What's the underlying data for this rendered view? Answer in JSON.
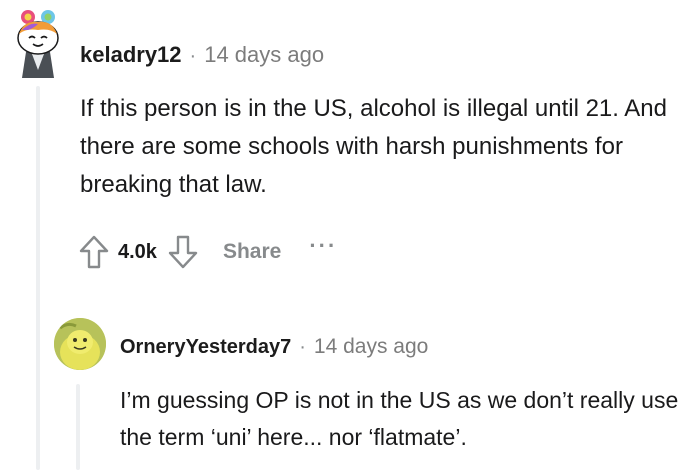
{
  "comments": [
    {
      "username": "keladry12",
      "separator": "·",
      "timestamp": "14 days ago",
      "body": "If this person is in the US, alcohol is illegal until 21. And there are some schools with harsh punishments for breaking that law.",
      "score": "4.0k",
      "share_label": "Share",
      "more_label": "···",
      "avatar_icon": "snoo-avatar-icon"
    },
    {
      "username": "OrneryYesterday7",
      "separator": "·",
      "timestamp": "14 days ago",
      "body": "I’m guessing OP is not in the US as we don’t really use the term ‘uni’ here... nor ‘flatmate’.",
      "avatar_icon": "profile-avatar-icon"
    }
  ],
  "colors": {
    "thread_line": "#edeff1",
    "meta_gray": "#7c7c7c",
    "action_gray": "#878a8c"
  }
}
